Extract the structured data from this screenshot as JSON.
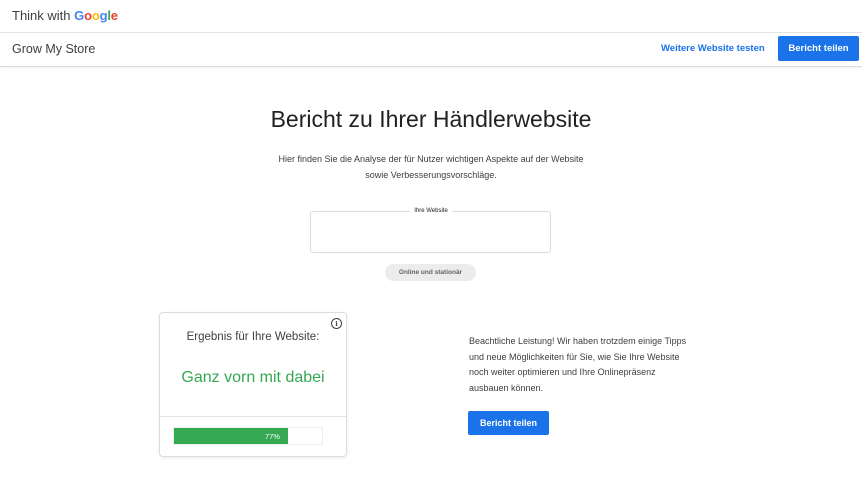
{
  "brand": {
    "prefix": "Think with",
    "google_letters": [
      {
        "char": "G",
        "color": "#4285F4"
      },
      {
        "char": "o",
        "color": "#EA4335"
      },
      {
        "char": "o",
        "color": "#FBBC05"
      },
      {
        "char": "g",
        "color": "#4285F4"
      },
      {
        "char": "l",
        "color": "#34A853"
      },
      {
        "char": "e",
        "color": "#EA4335"
      }
    ]
  },
  "header": {
    "store_name": "Grow My Store",
    "test_link": "Weitere Website testen",
    "share_button": "Bericht teilen"
  },
  "main": {
    "title": "Bericht zu Ihrer Händlerwebsite",
    "description_line1": "Hier finden Sie die Analyse der für Nutzer wichtigen Aspekte auf der Website",
    "description_line2": "sowie Verbesserungsvorschläge.",
    "website_label": "Ihre Website",
    "website_value": "",
    "business_type_chip": "Online und stationär"
  },
  "result_card": {
    "info_icon": "info-icon",
    "label": "Ergebnis für Ihre Website:",
    "result": "Ganz vorn mit dabei",
    "progress_percent": 77,
    "progress_text": "77%",
    "progress_color": "#34A853"
  },
  "advice": {
    "line1": "Beachtliche Leistung! Wir haben trotzdem einige Tipps",
    "line2": "und neue Möglichkeiten für Sie, wie Sie Ihre Website",
    "line3": "noch weiter optimieren und Ihre Onlinepräsenz",
    "line4": "ausbauen können.",
    "share_button": "Bericht teilen"
  },
  "colors": {
    "accent": "#1A73E8",
    "success": "#34A853"
  }
}
